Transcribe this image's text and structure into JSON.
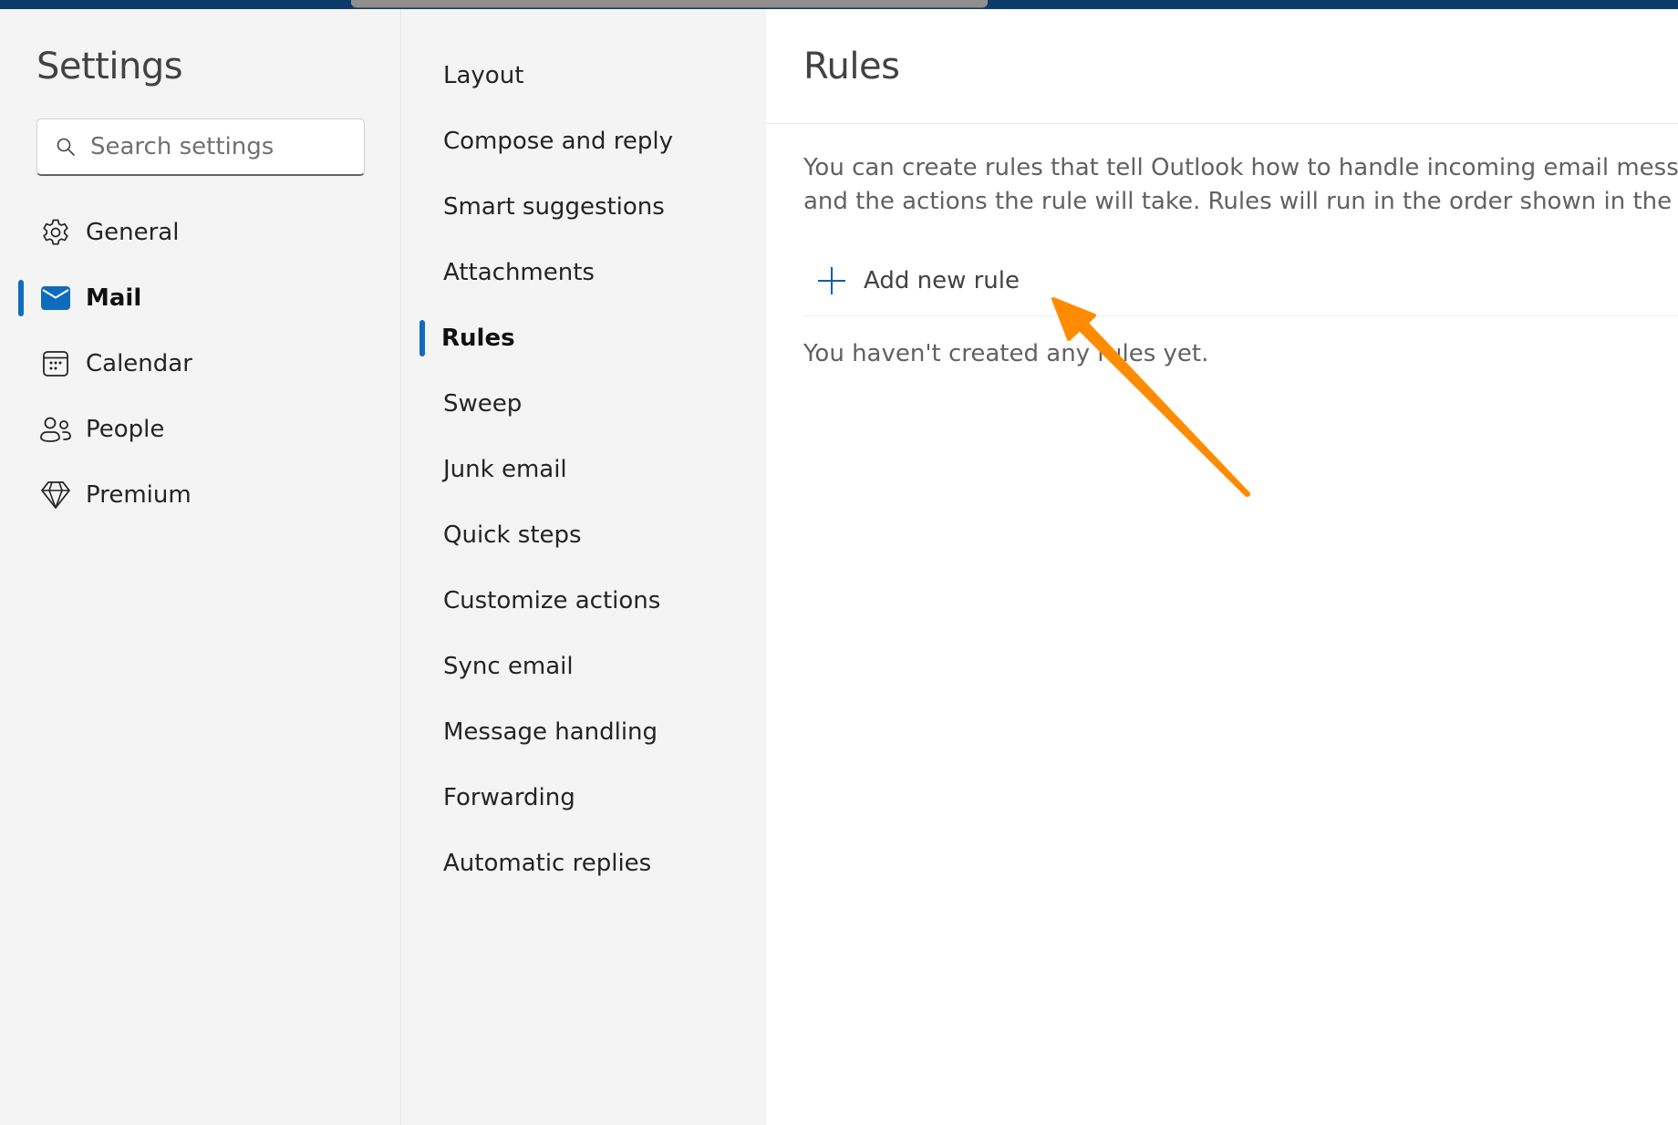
{
  "browser": {
    "top_bar_color": "#0c3b6a"
  },
  "left_pane": {
    "title": "Settings",
    "search": {
      "placeholder": "Search settings",
      "value": "",
      "icon": "search-icon"
    },
    "items": [
      {
        "label": "General",
        "icon": "gear-icon",
        "active": false
      },
      {
        "label": "Mail",
        "icon": "mail-icon",
        "active": true
      },
      {
        "label": "Calendar",
        "icon": "calendar-icon",
        "active": false
      },
      {
        "label": "People",
        "icon": "people-icon",
        "active": false
      },
      {
        "label": "Premium",
        "icon": "diamond-icon",
        "active": false
      }
    ]
  },
  "middle_pane": {
    "items": [
      {
        "label": "Layout"
      },
      {
        "label": "Compose and reply"
      },
      {
        "label": "Smart suggestions"
      },
      {
        "label": "Attachments"
      },
      {
        "label": "Rules",
        "active": true
      },
      {
        "label": "Sweep"
      },
      {
        "label": "Junk email"
      },
      {
        "label": "Quick steps"
      },
      {
        "label": "Customize actions"
      },
      {
        "label": "Sync email"
      },
      {
        "label": "Message handling"
      },
      {
        "label": "Forwarding"
      },
      {
        "label": "Automatic replies"
      }
    ]
  },
  "right_pane": {
    "title": "Rules",
    "description_line1": "You can create rules that tell Outlook how to handle incoming email messages",
    "description_line2": "and the actions the rule will take. Rules will run in the order shown in the list b",
    "add_rule_label": "Add new rule",
    "empty_message": "You haven't created any rules yet."
  },
  "annotation": {
    "type": "arrow",
    "color": "#ff8c00",
    "points_to": "add-new-rule-button"
  },
  "colors": {
    "accent": "#0f6cbd",
    "pane_bg": "#f4f4f4",
    "content_bg": "#ffffff"
  }
}
